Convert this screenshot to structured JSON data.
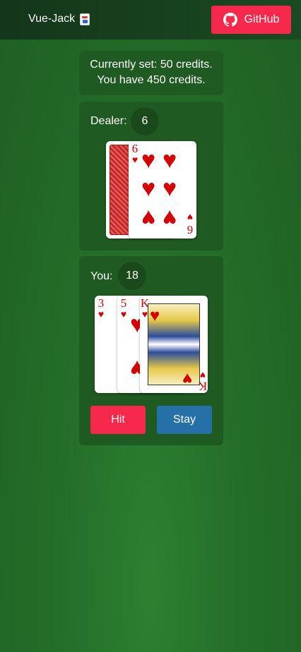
{
  "header": {
    "brand": "Vue-Jack",
    "github_label": "GitHub"
  },
  "credits": {
    "bet_line": "Currently set: 50 credits.",
    "balance_line": "You have 450 credits."
  },
  "dealer": {
    "label": "Dealer:",
    "score": "6",
    "cards": [
      {
        "face": "down"
      },
      {
        "rank": "6",
        "suit": "hearts",
        "suit_symbol": "♥"
      }
    ]
  },
  "player": {
    "label": "You:",
    "score": "18",
    "cards": [
      {
        "rank": "3",
        "suit": "hearts",
        "suit_symbol": "♥"
      },
      {
        "rank": "5",
        "suit": "hearts",
        "suit_symbol": "♥"
      },
      {
        "rank": "K",
        "suit": "hearts",
        "suit_symbol": "♥"
      }
    ]
  },
  "actions": {
    "hit_label": "Hit",
    "stay_label": "Stay"
  },
  "colors": {
    "accent_red": "#f6284b",
    "stay_blue": "#2670a8",
    "felt_green": "#256f2a",
    "card_red": "#d40000"
  }
}
